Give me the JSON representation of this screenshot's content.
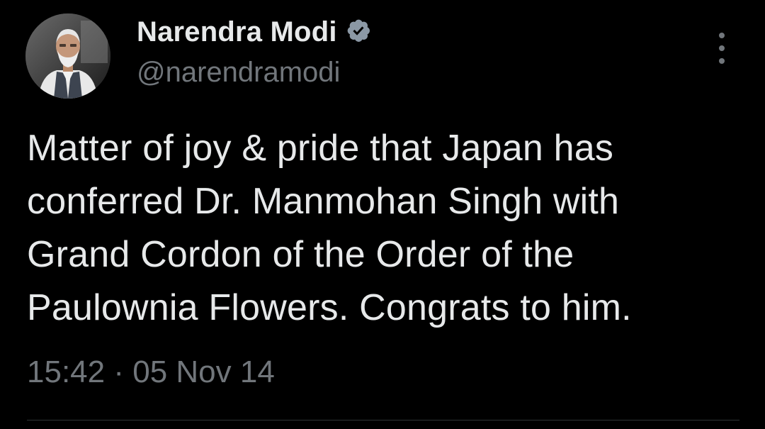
{
  "tweet": {
    "author": {
      "display_name": "Narendra Modi",
      "handle": "@narendramodi",
      "verified": true,
      "avatar_icon": "profile-photo",
      "verified_color": "#8b98a5"
    },
    "text": "Matter of joy & pride that Japan has\nconferred Dr. Manmohan Singh with\nGrand Cordon of the Order of the\nPaulownia Flowers. Congrats to him.",
    "time": "15:42",
    "separator": "·",
    "date": "05 Nov 14",
    "more_icon": "more-vertical-icon"
  },
  "colors": {
    "background": "#000000",
    "primary_text": "#e7e9ea",
    "secondary_text": "#71767b",
    "divider": "#2f3336"
  }
}
